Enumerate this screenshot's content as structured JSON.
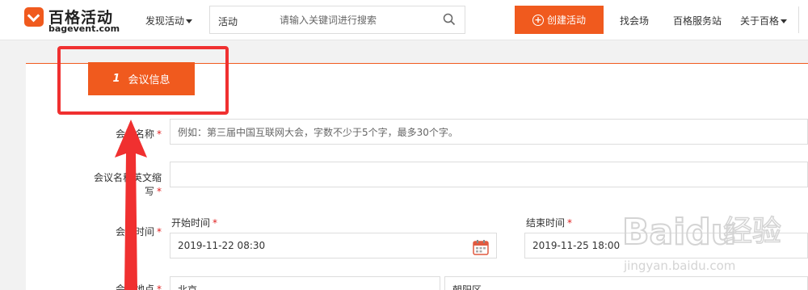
{
  "header": {
    "logo_cn": "百格活动",
    "logo_en": "bagevent.com",
    "discover_label": "发现活动",
    "search": {
      "type_label": "活动",
      "placeholder": "请输入关键词进行搜索"
    },
    "create_button": "创建活动",
    "nav": [
      "找会场",
      "百格服务站",
      "关于百格"
    ]
  },
  "step": {
    "number": "1",
    "label": "会议信息"
  },
  "form": {
    "meeting_name": {
      "label": "会议名称",
      "placeholder": "例如：第三届中国互联网大会，字数不少于5个字，最多30个字。"
    },
    "meeting_abbr": {
      "label_line1": "会议名称英文缩",
      "label_line2": "写"
    },
    "meeting_time": {
      "label": "会议时间",
      "start_label": "开始时间",
      "start_value": "2019-11-22 08:30",
      "end_label": "结束时间",
      "end_value": "2019-11-25 18:00"
    },
    "meeting_location": {
      "label": "会议地点",
      "province": "北京",
      "district": "朝阳区"
    }
  },
  "required_mark": "*",
  "watermark": {
    "brand": "Baidu",
    "cn": "经验",
    "url": "jingyan.baidu.com"
  },
  "colors": {
    "accent": "#f05a1e",
    "annotation": "#f03030",
    "required": "#e02020"
  }
}
